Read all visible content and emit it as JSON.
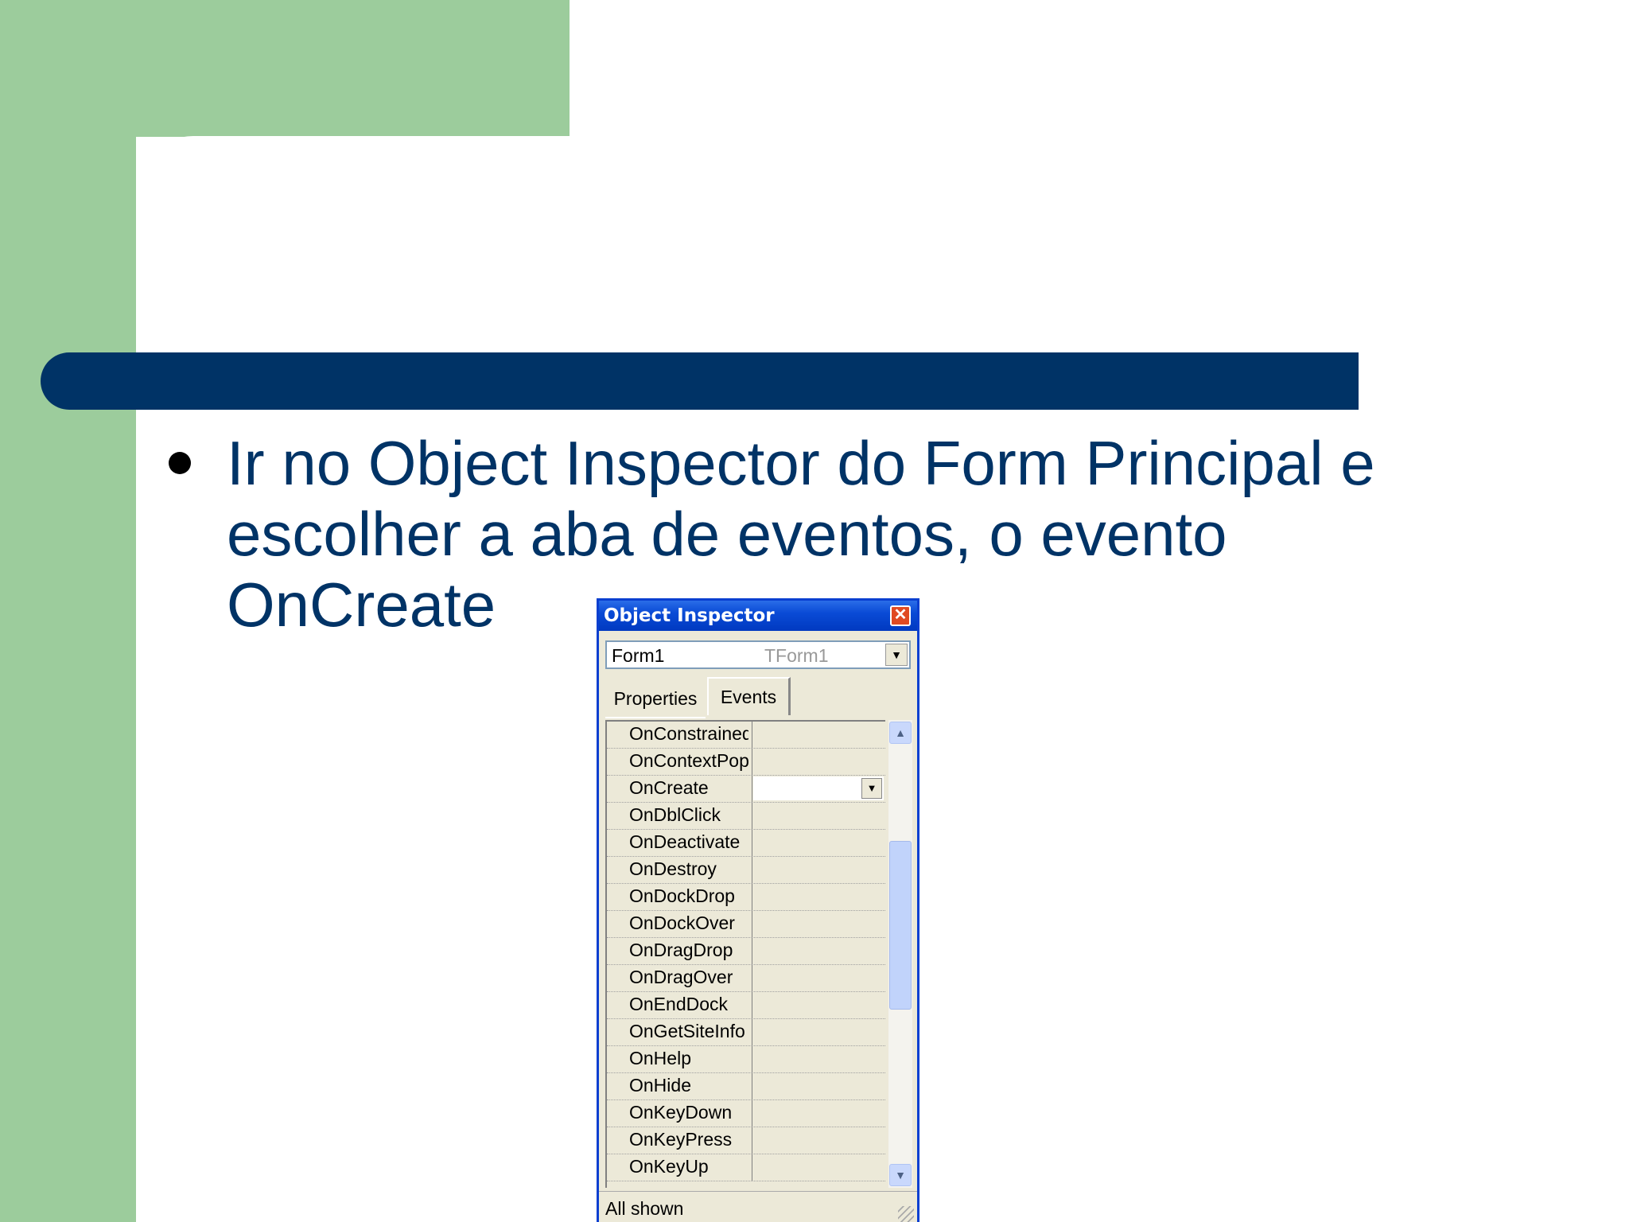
{
  "slide": {
    "bullet_text": "Ir no Object Inspector do Form Principal e escolher a aba de eventos, o evento OnCreate"
  },
  "object_inspector": {
    "title": "Object Inspector",
    "close_glyph": "✕",
    "selected_object": "Form1",
    "selected_type": "TForm1",
    "tabs": [
      "Properties",
      "Events"
    ],
    "active_tab": "Events",
    "events": [
      "OnConstrainedResize",
      "OnContextPopup",
      "OnCreate",
      "OnDblClick",
      "OnDeactivate",
      "OnDestroy",
      "OnDockDrop",
      "OnDockOver",
      "OnDragDrop",
      "OnDragOver",
      "OnEndDock",
      "OnGetSiteInfo",
      "OnHelp",
      "OnHide",
      "OnKeyDown",
      "OnKeyPress",
      "OnKeyUp"
    ],
    "selected_event": "OnCreate",
    "status": "All shown"
  }
}
